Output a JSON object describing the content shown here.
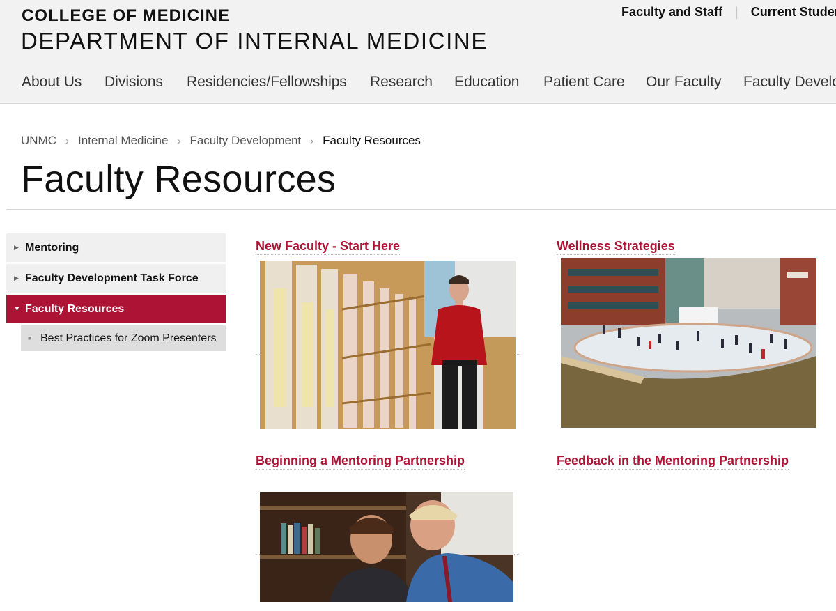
{
  "header": {
    "college": "COLLEGE OF MEDICINE",
    "department": "DEPARTMENT OF INTERNAL MEDICINE",
    "utility_links": [
      "Faculty and Staff",
      "Current Studer"
    ]
  },
  "nav": {
    "items": [
      "About Us",
      "Divisions",
      "Residencies/Fellowships",
      "Research",
      "Education",
      "Patient Care",
      "Our Faculty",
      "Faculty Develo"
    ]
  },
  "breadcrumb": [
    "UNMC",
    "Internal Medicine",
    "Faculty Development",
    "Faculty Resources"
  ],
  "page_title": "Faculty Resources",
  "sidebar": {
    "items": [
      {
        "label": "Mentoring",
        "active": false
      },
      {
        "label": "Faculty Development Task Force",
        "active": false
      },
      {
        "label": "Faculty Resources",
        "active": true
      }
    ],
    "subitems": [
      "Best Practices for Zoom Presenters"
    ]
  },
  "cards": [
    {
      "title": "New Faculty - Start Here"
    },
    {
      "title": "Wellness Strategies"
    },
    {
      "title": "Beginning a Mentoring Partnership"
    },
    {
      "title": "Feedback in the Mentoring Partnership"
    }
  ],
  "colors": {
    "brand": "#ad1335",
    "header_bg": "#f2f2f2",
    "sidebar_bg": "#f0f0f0",
    "sub_bg": "#dedede"
  }
}
